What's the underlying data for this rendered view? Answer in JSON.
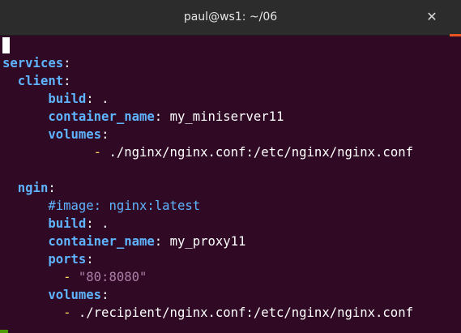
{
  "window": {
    "title": "paul@ws1: ~/06",
    "close_glyph": "✕"
  },
  "editor": {
    "services_key": "services",
    "client": {
      "key": "client",
      "build_key": "build",
      "build_val": ".",
      "container_key": "container_name",
      "container_val": "my_miniserver11",
      "volumes_key": "volumes",
      "volume_item": "./nginx/nginx.conf:/etc/nginx/nginx.conf"
    },
    "ngin": {
      "key": "ngin",
      "comment": "#image: nginx:latest",
      "build_key": "build",
      "build_val": ".",
      "container_key": "container_name",
      "container_val": "my_proxy11",
      "ports_key": "ports",
      "port_item": "\"80:8080\"",
      "volumes_key": "volumes",
      "volume_item": "./recipient/nginx.conf:/etc/nginx/nginx.conf"
    },
    "colon": ":",
    "dash": "-"
  },
  "colors": {
    "background": "#300a24",
    "key": "#5fb4ff",
    "dash": "#ffd75f",
    "string": "#ad7fa8",
    "accent": "#e95420"
  }
}
